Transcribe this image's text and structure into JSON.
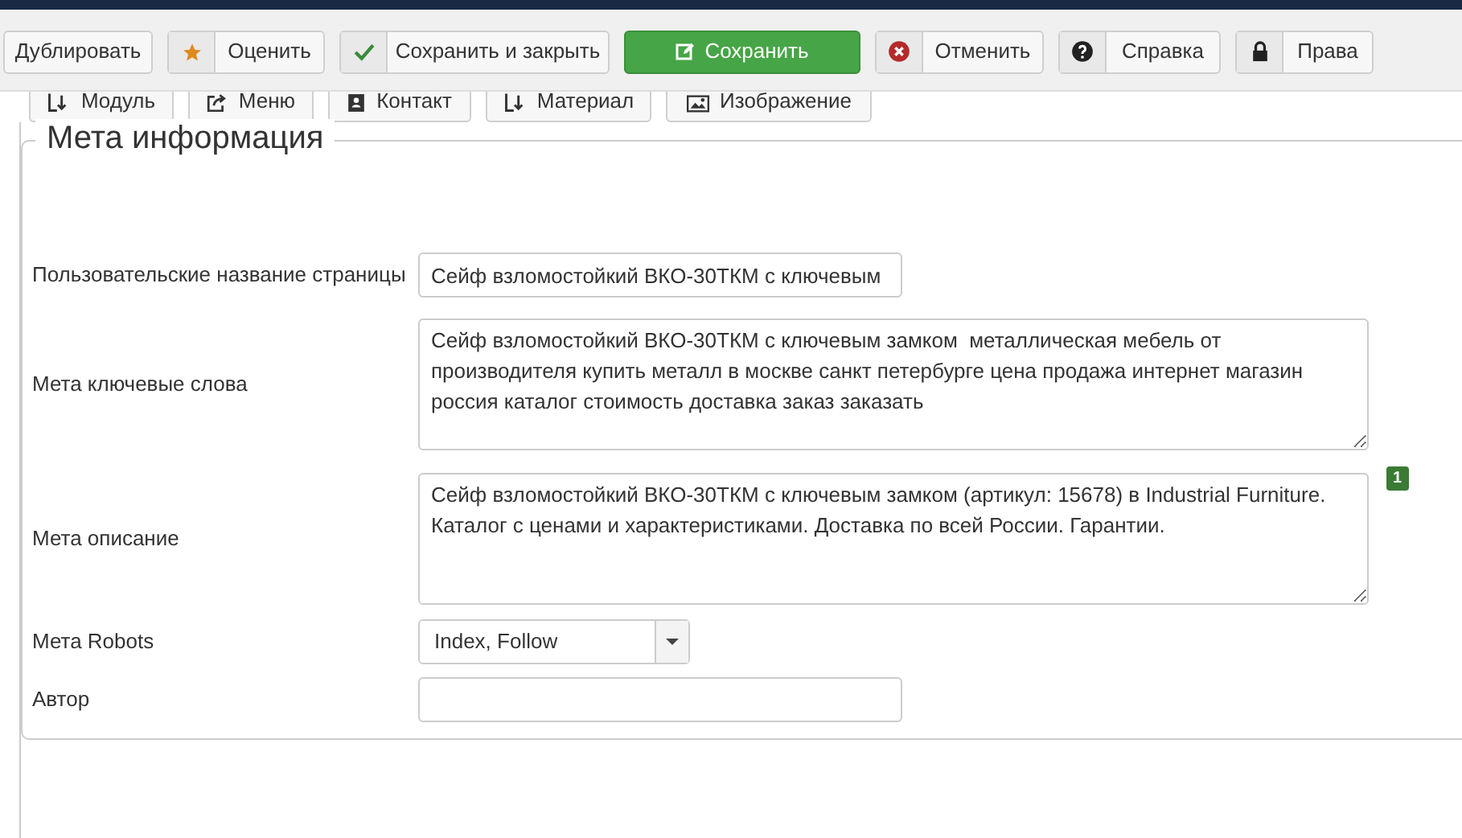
{
  "toolbar": {
    "buttons": [
      {
        "label": "Дублировать",
        "kind": "plain"
      },
      {
        "label": "Оценить",
        "kind": "icon"
      },
      {
        "label": "Сохранить и закрыть",
        "kind": "icon"
      },
      {
        "label": "Сохранить",
        "kind": "primary"
      },
      {
        "label": "Отменить",
        "kind": "icon"
      },
      {
        "label": "Справка",
        "kind": "icon"
      },
      {
        "label": "Права",
        "kind": "icon"
      }
    ]
  },
  "editor_buttons": [
    "Модуль",
    "Меню",
    "Контакт",
    "Материал",
    "Изображение"
  ],
  "fieldset": {
    "legend": "Мета информация",
    "fields": [
      {
        "label": "Пользовательские название страницы",
        "kind": "input",
        "value": "Сейф взломостойкий ВКО-30ТКМ с ключевым"
      },
      {
        "label": "Мета ключевые слова",
        "kind": "textarea",
        "value": "Сейф взломостойкий ВКО-30ТКМ с ключевым замком  металлическая мебель от производителя купить металл в москве санкт петербурге цена продажа интернет магазин россия каталог стоимость доставка заказ заказать"
      },
      {
        "label": "Мета описание",
        "kind": "textarea",
        "value": "Сейф взломостойкий ВКО-30ТКМ с ключевым замком (артикул: 15678) в Industrial Furniture. Каталог с ценами и характеристиками. Доставка по всей России. Гарантии.",
        "badge": "1"
      },
      {
        "label": "Мета Robots",
        "kind": "select",
        "value": "Index, Follow"
      },
      {
        "label": "Автор",
        "kind": "input"
      }
    ]
  }
}
